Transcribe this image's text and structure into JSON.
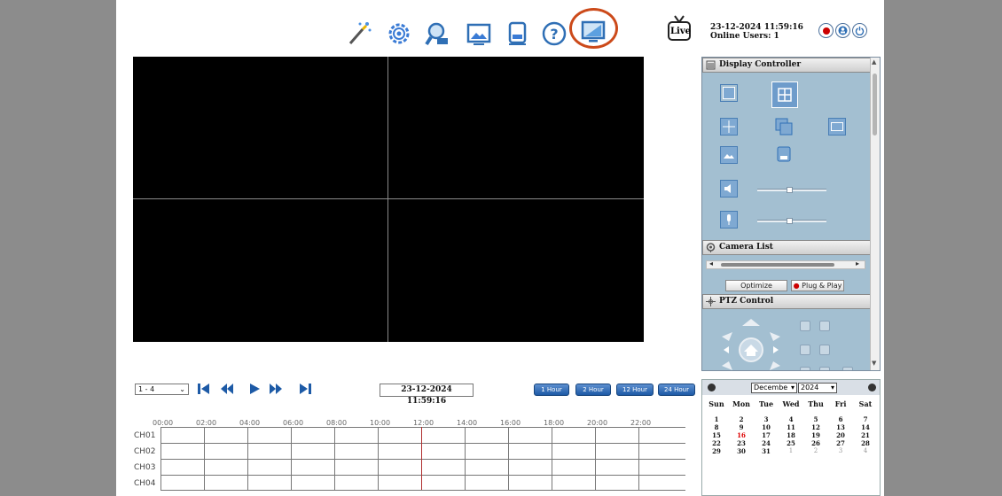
{
  "header": {
    "datetime": "23-12-2024 11:59:16",
    "online_users": "Online Users: 1",
    "live_label": "Live"
  },
  "toolbar": {
    "icons": [
      "magic-wand-icon",
      "settings-gear-icon",
      "search-camera-icon",
      "image-icon",
      "device-icon",
      "help-icon",
      "monitor-icon"
    ],
    "highlight_color": "#cc4a1a"
  },
  "panel": {
    "display_controller": "Display Controller",
    "camera_list": "Camera List",
    "optimize": "Optimize",
    "plug_play": "Plug & Play",
    "ptz_control": "PTZ Control"
  },
  "playback": {
    "channel_select": "1 - 4",
    "time": "23-12-2024 11:59:16",
    "hour_buttons": [
      "1 Hour",
      "2 Hour",
      "12 Hour",
      "24 Hour"
    ]
  },
  "timeline": {
    "hours": [
      "00:00",
      "02:00",
      "04:00",
      "06:00",
      "08:00",
      "10:00",
      "12:00",
      "14:00",
      "16:00",
      "18:00",
      "20:00",
      "22:00"
    ],
    "channels": [
      "CH01",
      "CH02",
      "CH03",
      "CH04"
    ]
  },
  "calendar": {
    "month": "Decembe",
    "year": "2024",
    "weekdays": [
      "Sun",
      "Mon",
      "Tue",
      "Wed",
      "Thu",
      "Fri",
      "Sat"
    ],
    "weeks": [
      [
        "1",
        "2",
        "3",
        "4",
        "5",
        "6",
        "7"
      ],
      [
        "8",
        "9",
        "10",
        "11",
        "12",
        "13",
        "14"
      ],
      [
        "15",
        "16",
        "17",
        "18",
        "19",
        "20",
        "21"
      ],
      [
        "22",
        "23",
        "24",
        "25",
        "26",
        "27",
        "28"
      ],
      [
        "29",
        "30",
        "31",
        "1",
        "2",
        "3",
        "4"
      ]
    ],
    "today": "16"
  },
  "colors": {
    "button_blue": "#1d5aa6",
    "panel_bg": "#a3bfd1",
    "record_red": "#cc0000"
  }
}
